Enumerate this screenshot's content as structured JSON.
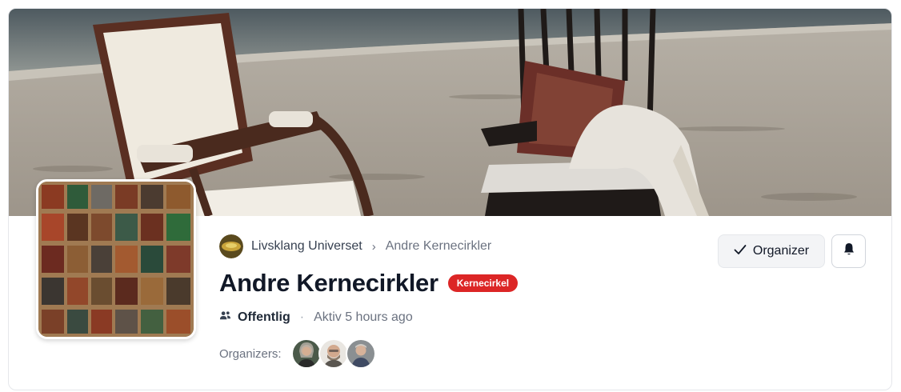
{
  "breadcrumb": {
    "parent": "Livsklang Universet",
    "separator": "›",
    "current": "Andre Kernecirkler"
  },
  "group": {
    "title": "Andre Kernecirkler",
    "badge": "Kernecirkel",
    "badge_color": "#dc2626",
    "privacy": "Offentlig",
    "activity": "Aktiv 5 hours ago",
    "organizers_label": "Organizers:"
  },
  "actions": {
    "organizer_label": "Organizer",
    "organizer_icon": "check-icon",
    "bell_icon": "bell-icon"
  },
  "organizers": [
    "organizer-1",
    "organizer-2",
    "organizer-3"
  ]
}
